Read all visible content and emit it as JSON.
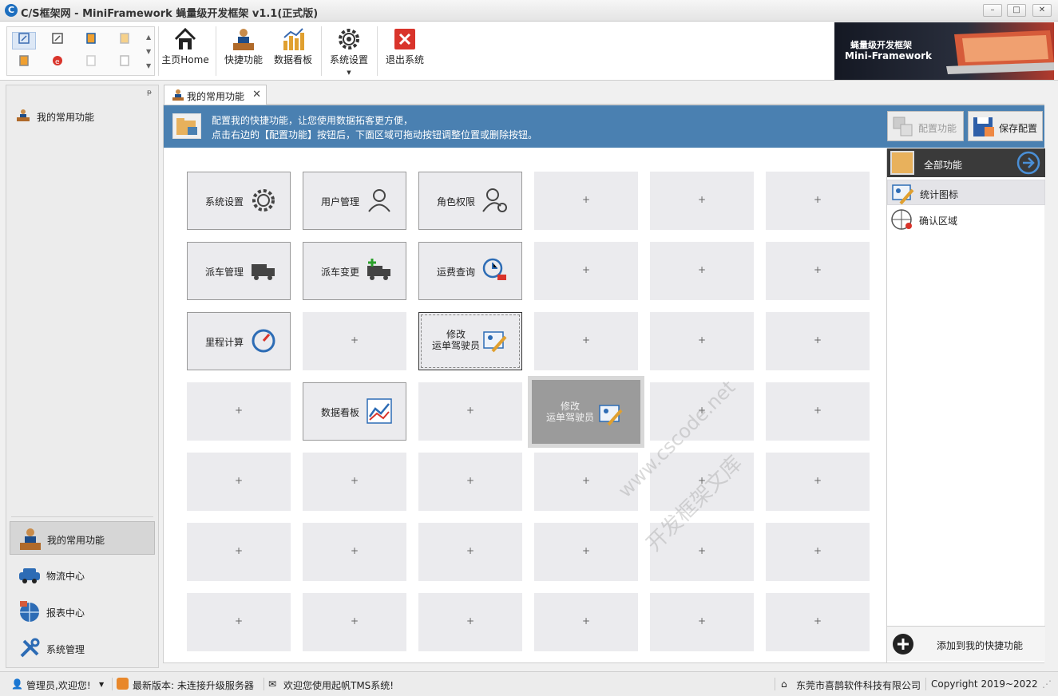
{
  "window": {
    "title": "C/S框架网 - MiniFramework 蝇量级开发框架 v1.1(正式版)",
    "min": "–",
    "max": "□",
    "close": "✕"
  },
  "ribbon": {
    "buttons": [
      {
        "label": "主页Home",
        "icon": "home-icon"
      },
      {
        "label": "快捷功能",
        "icon": "person-desk-icon"
      },
      {
        "label": "数据看板",
        "icon": "bar-chart-icon"
      },
      {
        "label": "系统设置",
        "icon": "gear-icon"
      },
      {
        "label": "退出系统",
        "icon": "exit-icon"
      }
    ],
    "banner_line1": "蝇量级开发框架",
    "banner_line2": "Mini-Framework"
  },
  "leftnav": {
    "top_item": "我的常用功能",
    "bottom_items": [
      {
        "label": "我的常用功能",
        "icon": "person-desk-icon",
        "active": true
      },
      {
        "label": "物流中心",
        "icon": "car-icon"
      },
      {
        "label": "报表中心",
        "icon": "globe-icon"
      },
      {
        "label": "系统管理",
        "icon": "tools-icon"
      }
    ]
  },
  "tab": {
    "label": "我的常用功能",
    "close": "✕"
  },
  "infobar": {
    "line1": "配置我的快捷功能，让您使用数据拓客更方便，",
    "line2": "点击右边的【配置功能】按钮后，下面区域可拖动按钮调整位置或删除按钮。",
    "config_button": "配置功能",
    "save_button": "保存配置"
  },
  "grid": {
    "plus": "+",
    "functions": [
      {
        "label": "系统设置",
        "icon": "gear-icon"
      },
      {
        "label": "用户管理",
        "icon": "users-icon"
      },
      {
        "label": "角色权限",
        "icon": "user-settings-icon"
      },
      {
        "label": "派车管理",
        "icon": "truck-icon"
      },
      {
        "label": "派车变更",
        "icon": "truck-add-icon"
      },
      {
        "label": "运费查询",
        "icon": "clock-cart-icon"
      },
      {
        "label": "里程计算",
        "icon": "speedometer-icon"
      },
      {
        "label": "修改\n运单驾驶员",
        "icon": "edit-card-icon"
      },
      {
        "label": "数据看板",
        "icon": "line-chart-icon"
      },
      {
        "label": "修改\n运单驾驶员",
        "icon": "edit-card-icon"
      }
    ]
  },
  "watermark": {
    "line1": "www.cscode.net",
    "line2": "开发框架文库"
  },
  "funcpanel": {
    "header": "全部功能",
    "items": [
      {
        "label": "统计图标",
        "icon": "edit-card-icon"
      },
      {
        "label": "确认区域",
        "icon": "globe-pin-icon"
      }
    ],
    "add_button": "添加到我的快捷功能"
  },
  "statusbar": {
    "user": "管理员,欢迎您!",
    "version": "最新版本: 未连接升级服务器",
    "message": "欢迎您使用起帆TMS系统!",
    "company": "东莞市喜鹊软件科技有限公司",
    "copyright": "Copyright 2019~2022"
  },
  "colors": {
    "accent": "#4a80b1",
    "tile": "#ebebee",
    "ghost": "#9b9b9b"
  }
}
